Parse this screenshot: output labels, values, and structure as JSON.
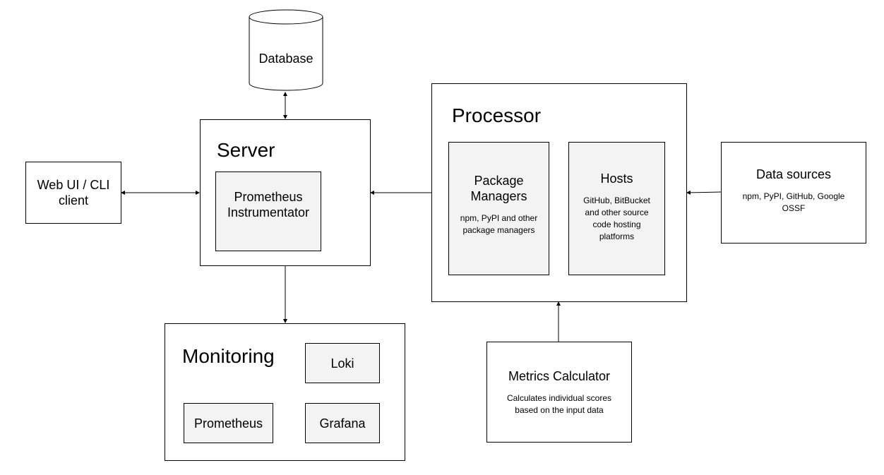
{
  "database": {
    "label": "Database"
  },
  "client": {
    "label": "Web UI / CLI client"
  },
  "server": {
    "title": "Server",
    "instrumentator": "Prometheus Instrumentator"
  },
  "processor": {
    "title": "Processor",
    "package_managers": {
      "label": "Package Managers",
      "desc": "npm, PyPI and other package managers"
    },
    "hosts": {
      "label": "Hosts",
      "desc": "GitHub, BitBucket and other source code hosting platforms"
    }
  },
  "data_sources": {
    "label": "Data sources",
    "desc": "npm, PyPI, GitHub, Google OSSF"
  },
  "metrics": {
    "label": "Metrics Calculator",
    "desc": "Calculates individual scores based on the input data"
  },
  "monitoring": {
    "title": "Monitoring",
    "loki": "Loki",
    "prometheus": "Prometheus",
    "grafana": "Grafana"
  },
  "colors": {
    "inner_fill": "#f3f3f3",
    "stroke": "#000000"
  }
}
